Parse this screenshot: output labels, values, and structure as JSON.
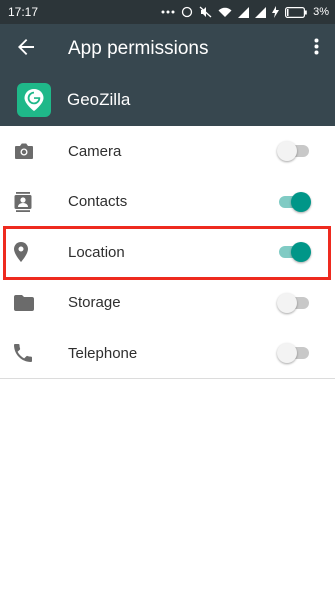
{
  "status_bar": {
    "time": "17:17",
    "battery": "3%",
    "icons": [
      "more-dots-icon",
      "alarm-icon",
      "mute-icon",
      "wifi-icon",
      "signal-icon",
      "signal-icon",
      "charging-icon",
      "battery-icon"
    ]
  },
  "app_bar": {
    "title": "App permissions",
    "back_icon": "arrow-back-icon",
    "more_icon": "more-vertical-icon"
  },
  "app": {
    "name": "GeoZilla",
    "icon": "geozilla-logo-icon",
    "icon_color": "#1fb889"
  },
  "permissions": [
    {
      "label": "Camera",
      "icon": "camera-icon",
      "enabled": false
    },
    {
      "label": "Contacts",
      "icon": "contacts-icon",
      "enabled": true
    },
    {
      "label": "Location",
      "icon": "location-pin-icon",
      "enabled": true
    },
    {
      "label": "Storage",
      "icon": "folder-icon",
      "enabled": false
    },
    {
      "label": "Telephone",
      "icon": "phone-icon",
      "enabled": false
    }
  ],
  "colors": {
    "toolbar": "#37474f",
    "status_bar": "#2c3539",
    "toggle_on": "#009688",
    "highlight": "#ee2a1f"
  }
}
